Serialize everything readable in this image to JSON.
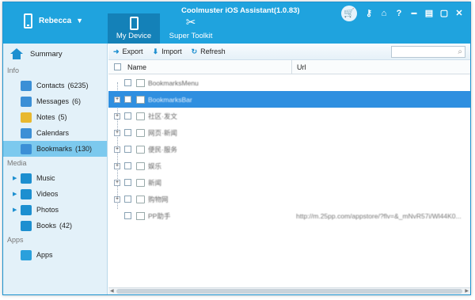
{
  "app": {
    "title": "Coolmuster iOS Assistant(1.0.83)",
    "device_name": "Rebecca"
  },
  "tabs": [
    {
      "label": "My Device",
      "active": true,
      "icon": "phone-icon"
    },
    {
      "label": "Super Toolkit",
      "active": false,
      "icon": "tools-icon"
    }
  ],
  "titlebar_icons": [
    "cart-icon",
    "key-icon",
    "home-icon",
    "help-icon",
    "minimize-icon",
    "feedback-icon",
    "restore-icon",
    "close-icon"
  ],
  "titlebar_glyphs": {
    "key": "⚷",
    "home": "⌂",
    "help": "?",
    "minimize": "▬",
    "feedback": "▤",
    "restore": "▢",
    "close": "✕",
    "cart": "🛒"
  },
  "sidebar": {
    "summary": "Summary",
    "sections": {
      "info": "Info",
      "media": "Media",
      "apps": "Apps"
    },
    "info_items": [
      {
        "label": "Contacts",
        "count": "(6235)",
        "color": "#3b8fd6"
      },
      {
        "label": "Messages",
        "count": "(6)",
        "color": "#3b8fd6"
      },
      {
        "label": "Notes",
        "count": "(5)",
        "color": "#e8b830"
      },
      {
        "label": "Calendars",
        "count": "",
        "color": "#3b8fd6"
      },
      {
        "label": "Bookmarks",
        "count": "(130)",
        "color": "#3b8fd6",
        "selected": true
      }
    ],
    "media_items": [
      {
        "label": "Music",
        "count": "",
        "color": "#1d8fd0",
        "expandable": true
      },
      {
        "label": "Videos",
        "count": "",
        "color": "#1d8fd0",
        "expandable": true
      },
      {
        "label": "Photos",
        "count": "",
        "color": "#1d8fd0",
        "expandable": true
      },
      {
        "label": "Books",
        "count": "(42)",
        "color": "#1d8fd0",
        "expandable": false
      }
    ],
    "app_items": [
      {
        "label": "Apps",
        "count": "",
        "color": "#2aa0dc"
      }
    ]
  },
  "toolbar": {
    "export_label": "Export",
    "import_label": "Import",
    "refresh_label": "Refresh",
    "search_placeholder": ""
  },
  "table": {
    "headers": {
      "name": "Name",
      "url": "Url"
    },
    "rows": [
      {
        "name": "BookmarksMenu",
        "url": "",
        "type": "doc",
        "expandable": false,
        "selected": false
      },
      {
        "name": "BookmarksBar",
        "url": "",
        "type": "folder",
        "expandable": true,
        "selected": true
      },
      {
        "name": "社区·发文",
        "url": "",
        "type": "folder",
        "expandable": true,
        "selected": false
      },
      {
        "name": "网页·新闻",
        "url": "",
        "type": "folder",
        "expandable": true,
        "selected": false
      },
      {
        "name": "便民·服务",
        "url": "",
        "type": "folder",
        "expandable": true,
        "selected": false
      },
      {
        "name": "娱乐",
        "url": "",
        "type": "folder",
        "expandable": true,
        "selected": false
      },
      {
        "name": "新闻",
        "url": "",
        "type": "folder",
        "expandable": true,
        "selected": false
      },
      {
        "name": "购物网",
        "url": "",
        "type": "folder",
        "expandable": true,
        "selected": false
      },
      {
        "name": "PP助手",
        "url": "http://m.25pp.com/appstore/?flv=&_mNvR57i/Wl44K0...",
        "type": "doc",
        "expandable": false,
        "selected": false
      }
    ]
  }
}
